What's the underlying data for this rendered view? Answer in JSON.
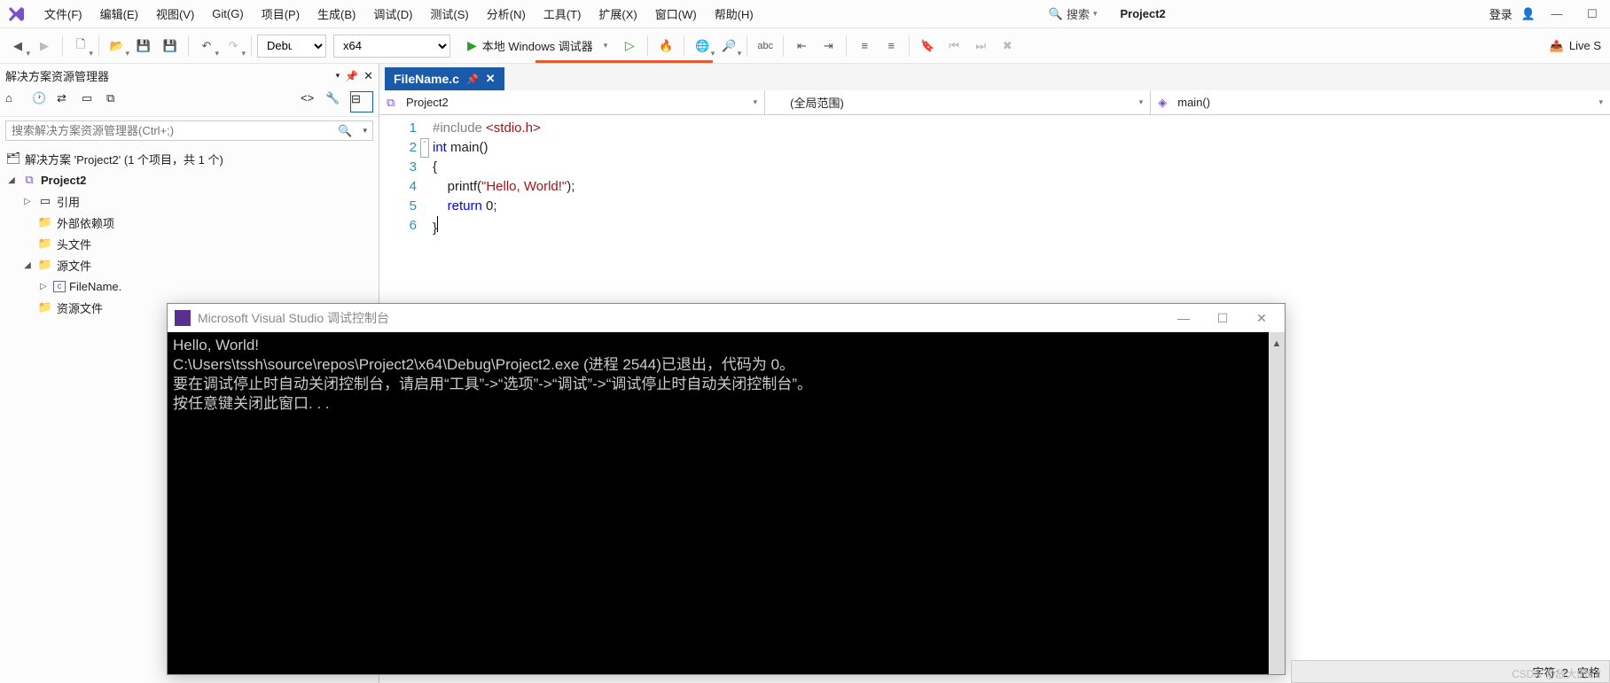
{
  "menu": {
    "items": [
      "文件(F)",
      "编辑(E)",
      "视图(V)",
      "Git(G)",
      "项目(P)",
      "生成(B)",
      "调试(D)",
      "测试(S)",
      "分析(N)",
      "工具(T)",
      "扩展(X)",
      "窗口(W)",
      "帮助(H)"
    ],
    "search_label": "搜索",
    "project_badge": "Project2",
    "login": "登录"
  },
  "toolbar": {
    "config": "Debug",
    "platform": "x64",
    "run_label": "本地 Windows 调试器",
    "live_share": "Live S"
  },
  "solution_panel": {
    "title": "解决方案资源管理器",
    "search_placeholder": "搜索解决方案资源管理器(Ctrl+;)",
    "solution_line": "解决方案 'Project2' (1 个项目，共 1 个)",
    "project": "Project2",
    "nodes": {
      "references": "引用",
      "external": "外部依赖项",
      "headers": "头文件",
      "sources": "源文件",
      "filename": "FileName.",
      "resources": "资源文件"
    }
  },
  "editor": {
    "tab_name": "FileName.c",
    "crumb1": "Project2",
    "crumb2": "(全局范围)",
    "crumb3": "main()",
    "lines": [
      "1",
      "2",
      "3",
      "4",
      "5",
      "6"
    ],
    "code": {
      "l1_pp": "#include ",
      "l1_inc": "<stdio.h>",
      "l2a": "int",
      "l2b": " main()",
      "l3": "{",
      "l4a": "    printf(",
      "l4b": "\"Hello, World!\"",
      "l4c": ");",
      "l5a": "    ",
      "l5b": "return",
      "l5c": " 0;",
      "l6": "}"
    }
  },
  "console": {
    "title": "Microsoft Visual Studio 调试控制台",
    "lines": [
      "Hello, World!",
      "C:\\Users\\tssh\\source\\repos\\Project2\\x64\\Debug\\Project2.exe (进程 2544)已退出，代码为 0。",
      "要在调试停止时自动关闭控制台，请启用“工具”->“选项”->“调试”->“调试停止时自动关闭控制台”。",
      "按任意键关闭此窗口. . ."
    ]
  },
  "status": {
    "char_label": "字符: 2",
    "space_label": "空格"
  },
  "watermark": "CSDN @放大的EZ"
}
